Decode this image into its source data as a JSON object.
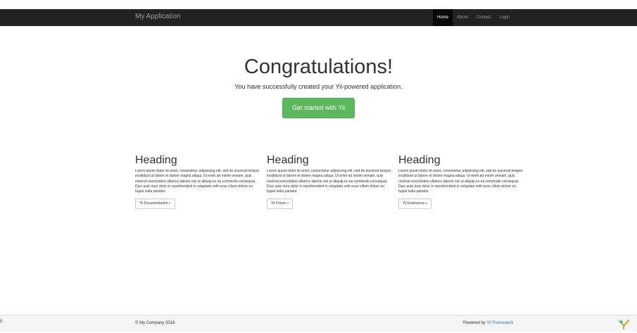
{
  "navbar": {
    "brand": "My Application",
    "items": [
      {
        "label": "Home",
        "active": true
      },
      {
        "label": "About",
        "active": false
      },
      {
        "label": "Contact",
        "active": false
      },
      {
        "label": "Login",
        "active": false
      }
    ]
  },
  "jumbotron": {
    "title": "Congratulations!",
    "lead": "You have successfully created your Yii-powered application.",
    "button": "Get started with Yii"
  },
  "columns": [
    {
      "heading": "Heading",
      "body": "Lorem ipsum dolor sit amet, consectetur adipisicing elit, sed do eiusmod tempor incididunt ut labore et dolore magna aliqua. Ut enim ad minim veniam, quis nostrud exercitation ullamco laboris nisi ut aliquip ex ea commodo consequat. Duis aute irure dolor in reprehenderit in voluptate velit esse cillum dolore eu fugiat nulla pariatur.",
      "button": "Yii Documentation »"
    },
    {
      "heading": "Heading",
      "body": "Lorem ipsum dolor sit amet, consectetur adipisicing elit, sed do eiusmod tempor incididunt ut labore et dolore magna aliqua. Ut enim ad minim veniam, quis nostrud exercitation ullamco laboris nisi ut aliquip ex ea commodo consequat. Duis aute irure dolor in reprehenderit in voluptate velit esse cillum dolore eu fugiat nulla pariatur.",
      "button": "Yii Forum »"
    },
    {
      "heading": "Heading",
      "body": "Lorem ipsum dolor sit amet, consectetur adipisicing elit, sed do eiusmod tempor incididunt ut labore et dolore magna aliqua. Ut enim ad minim veniam, quis nostrud exercitation ullamco laboris nisi ut aliquip ex ea commodo consequat. Duis aute irure dolor in reprehenderit in voluptate velit esse cillum dolore eu fugiat nulla pariatur.",
      "button": "Yii Extensions »"
    }
  ],
  "footer": {
    "edge_text": "0",
    "copyright": "© My Company 2018",
    "powered_prefix": "Powered by ",
    "powered_link": "Yii Framework"
  },
  "colors": {
    "navbar_bg": "#222222",
    "success": "#5cb85c",
    "link": "#337ab7"
  },
  "icons": {
    "footer_logo": "yii-logo-icon"
  }
}
